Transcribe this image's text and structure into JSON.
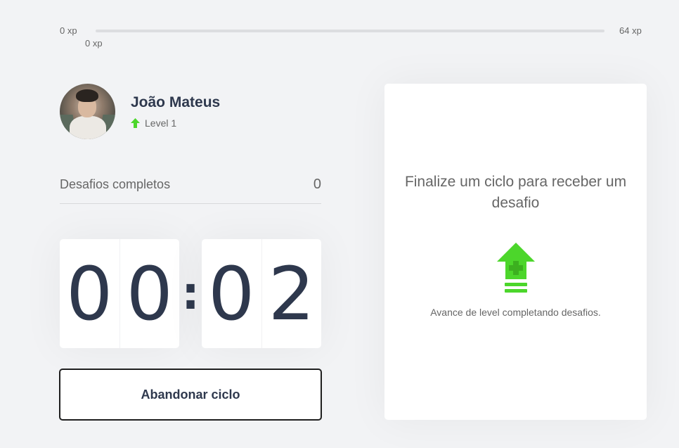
{
  "experience": {
    "min_label": "0 xp",
    "current_label": "0 xp",
    "max_label": "64 xp",
    "progress_fraction": 0.0
  },
  "profile": {
    "name": "João Mateus",
    "level_label": "Level 1",
    "level_icon": "level-up-arrow-icon"
  },
  "stats": {
    "completed_label": "Desafios completos",
    "completed_value": "0"
  },
  "countdown": {
    "minute_left": "0",
    "minute_right": "0",
    "separator": ":",
    "second_left": "0",
    "second_right": "2"
  },
  "actions": {
    "abandon_label": "Abandonar ciclo"
  },
  "challenge": {
    "title": "Finalize um ciclo para receber um desafio",
    "hint": "Avance de level completando desafios.",
    "icon": "level-up-icon"
  },
  "colors": {
    "background": "#f2f3f5",
    "accent_green": "#4cd62b",
    "text_title": "#2e384d",
    "text_muted": "#666666"
  }
}
